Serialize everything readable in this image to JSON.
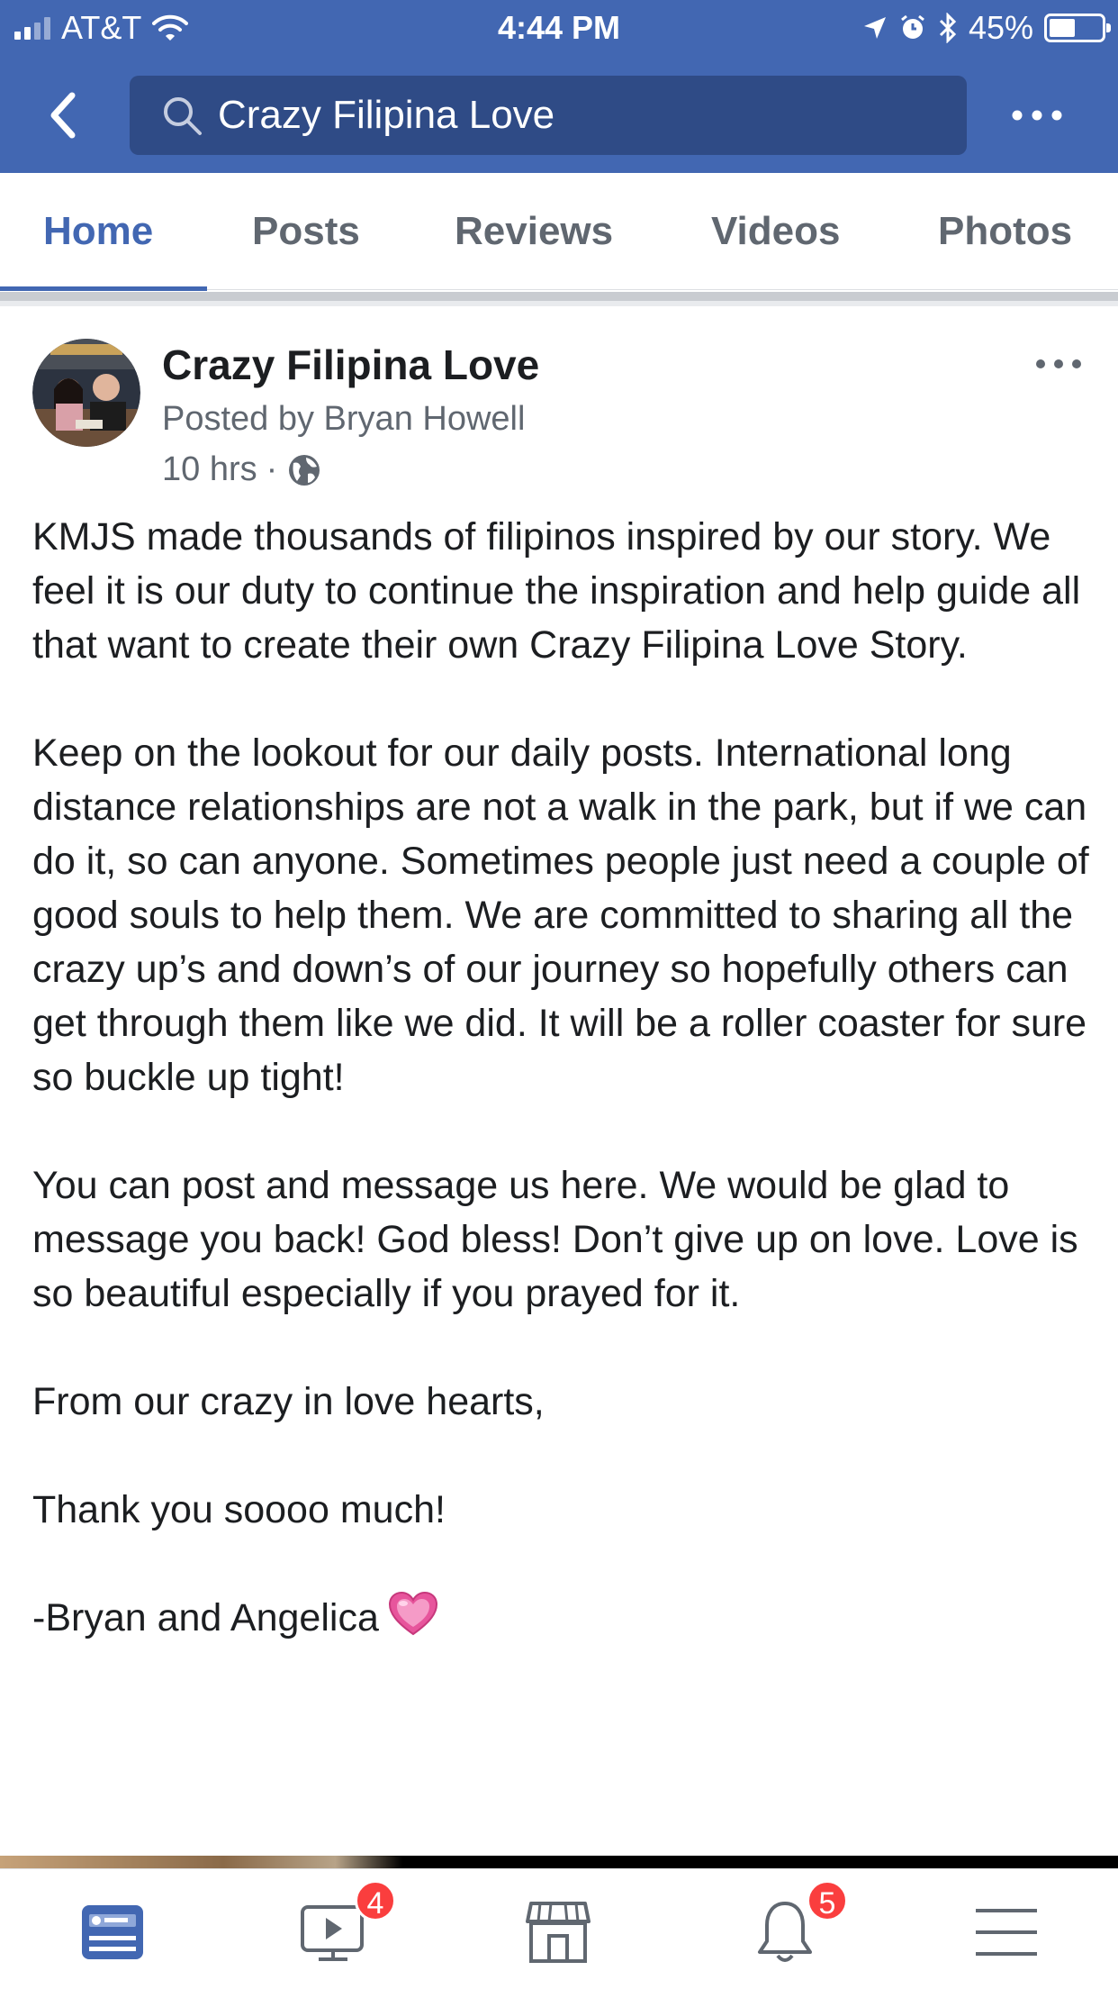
{
  "status_bar": {
    "carrier": "AT&T",
    "time": "4:44 PM",
    "battery": "45%",
    "battery_level": 0.45
  },
  "header": {
    "search_text": "Crazy Filipina Love"
  },
  "tabs": [
    {
      "label": "Home",
      "active": true
    },
    {
      "label": "Posts",
      "active": false
    },
    {
      "label": "Reviews",
      "active": false
    },
    {
      "label": "Videos",
      "active": false
    },
    {
      "label": "Photos",
      "active": false
    }
  ],
  "post": {
    "page_name": "Crazy Filipina Love",
    "posted_by": "Posted by Bryan Howell",
    "time_ago": "10 hrs",
    "meta_separator": "·",
    "paragraphs": [
      "KMJS made thousands of filipinos inspired by our story. We feel it is our duty to continue the inspiration and help guide all that want to create their own Crazy Filipina Love Story.",
      "Keep on the lookout for our daily posts. International long distance relationships are not a walk in the park, but if we can do it, so can anyone. Sometimes people just need a couple of good souls to help them. We are committed to sharing all the crazy up’s and down’s of our journey so hopefully others can get through them like we did. It will be a roller coaster for sure so buckle up tight!",
      "You can post and message us here. We would be glad to message you back! God bless! Don’t give up on love. Love is so beautiful especially if you prayed for it.",
      "From our crazy in love hearts,",
      "Thank you soooo much!",
      "-Bryan and Angelica"
    ]
  },
  "bottom_nav": {
    "items": [
      {
        "icon": "news-feed-icon",
        "active": true
      },
      {
        "icon": "watch-icon",
        "badge": "4"
      },
      {
        "icon": "marketplace-icon"
      },
      {
        "icon": "notifications-icon",
        "badge": "5"
      },
      {
        "icon": "menu-icon"
      }
    ]
  },
  "colors": {
    "brand_blue": "#4267b2",
    "search_bg": "#2f4b86",
    "badge_red": "#fa3e3e",
    "muted_text": "#606770"
  }
}
